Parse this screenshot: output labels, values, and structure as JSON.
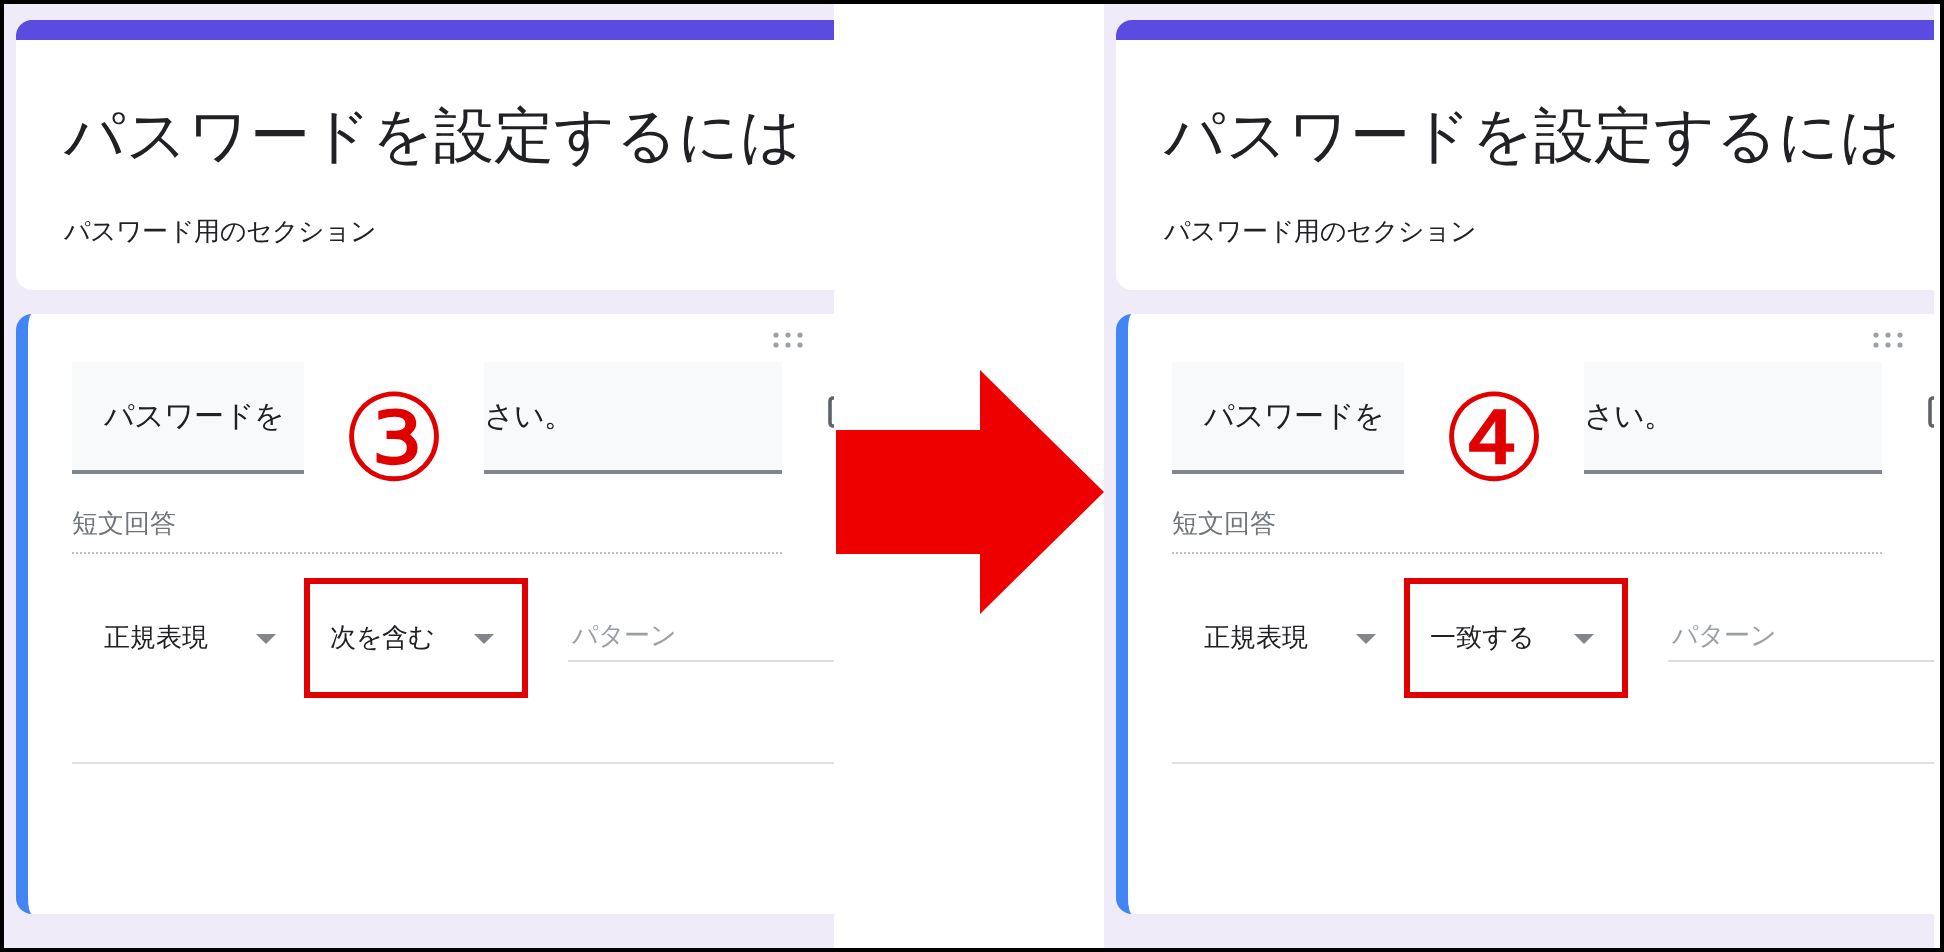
{
  "panels": [
    {
      "title": "パスワードを設定するには",
      "description": "パスワード用のセクション",
      "question_start": "パスワードを",
      "question_end": "さい。",
      "step_mark": "③",
      "answer_placeholder": "短文回答",
      "validation": {
        "type": "正規表現",
        "condition": "次を含む",
        "condition_highlighted": true,
        "pattern_placeholder": "パターン"
      }
    },
    {
      "title": "パスワードを設定するには",
      "description": "パスワード用のセクション",
      "question_start": "パスワードを",
      "question_end": "さい。",
      "step_mark": "④",
      "answer_placeholder": "短文回答",
      "validation": {
        "type": "正規表現",
        "condition": "一致する",
        "condition_highlighted": true,
        "pattern_placeholder": "パターン"
      }
    }
  ]
}
